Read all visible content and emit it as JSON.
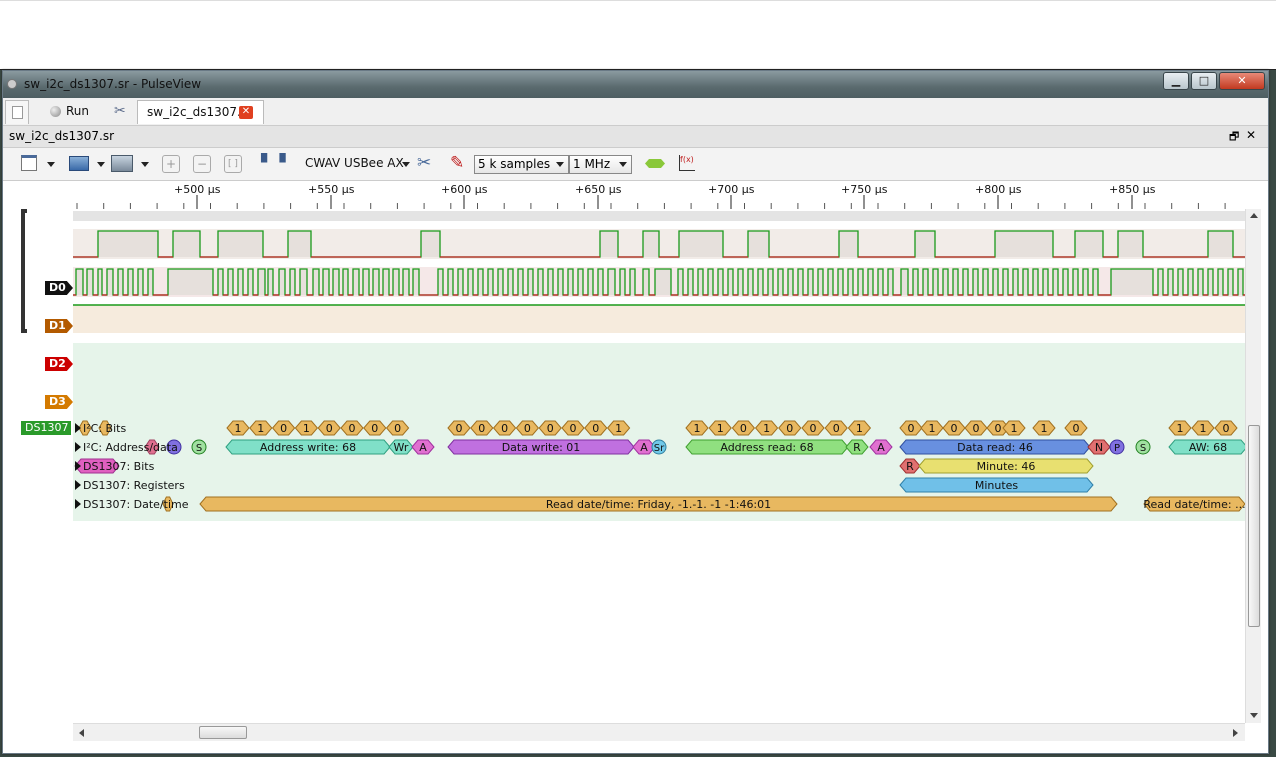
{
  "window": {
    "title": "sw_i2c_ds1307.sr - PulseView",
    "min": "▁",
    "max": "□",
    "close": "✕"
  },
  "tabs": {
    "run": "Run",
    "file": "sw_i2c_ds1307.sr",
    "close_icon": "close-icon"
  },
  "session": {
    "title": "sw_i2c_ds1307.sr",
    "restore": "🗗",
    "close": "✕"
  },
  "toolbar": {
    "device": "CWAV USBee AX",
    "samples": "5 k samples",
    "rate": "1 MHz"
  },
  "ruler": {
    "labels": [
      "+500 µs",
      "+550 µs",
      "+600 µs",
      "+650 µs",
      "+700 µs",
      "+750 µs",
      "+800 µs",
      "+850 µs"
    ]
  },
  "channels": [
    {
      "name": "D0",
      "color": "#111111"
    },
    {
      "name": "D1",
      "color": "#b35a00"
    },
    {
      "name": "D2",
      "color": "#cc0000"
    },
    {
      "name": "D3",
      "color": "#d47a00"
    }
  ],
  "decoder": {
    "name": "DS1307",
    "rows": [
      "I²C: Bits",
      "I²C: Address/data",
      "DS1307: Bits",
      "DS1307: Registers",
      "DS1307: Date/time"
    ]
  },
  "annotations": {
    "bits1": [
      "1",
      "1",
      "0",
      "1",
      "0",
      "0",
      "0",
      "0"
    ],
    "bits2": [
      "0",
      "0",
      "0",
      "0",
      "0",
      "0",
      "0",
      "1"
    ],
    "bits3": [
      "1",
      "1",
      "0",
      "1",
      "0",
      "0",
      "0",
      "1"
    ],
    "bits4": [
      "0",
      "1",
      "0",
      "0",
      "0",
      "1",
      "1",
      "0"
    ],
    "bits5": [
      "1",
      "1",
      "0"
    ],
    "start": "S",
    "addr_write": "Address write: 68",
    "wr": "Wr",
    "ack": "A",
    "data_write": "Data write: 01",
    "sr": "Sr",
    "addr_read": "Address read: 68",
    "r": "R",
    "data_read": "Data read: 46",
    "nack": "N",
    "stop": "P",
    "aw": "AW: 68",
    "ds_r": "R",
    "minute": "Minute: 46",
    "minutes": "Minutes",
    "datetime": "Read date/time: Friday, -1.-1.  -1 -1:46:01",
    "datetime2": "Read date/time: ..."
  }
}
